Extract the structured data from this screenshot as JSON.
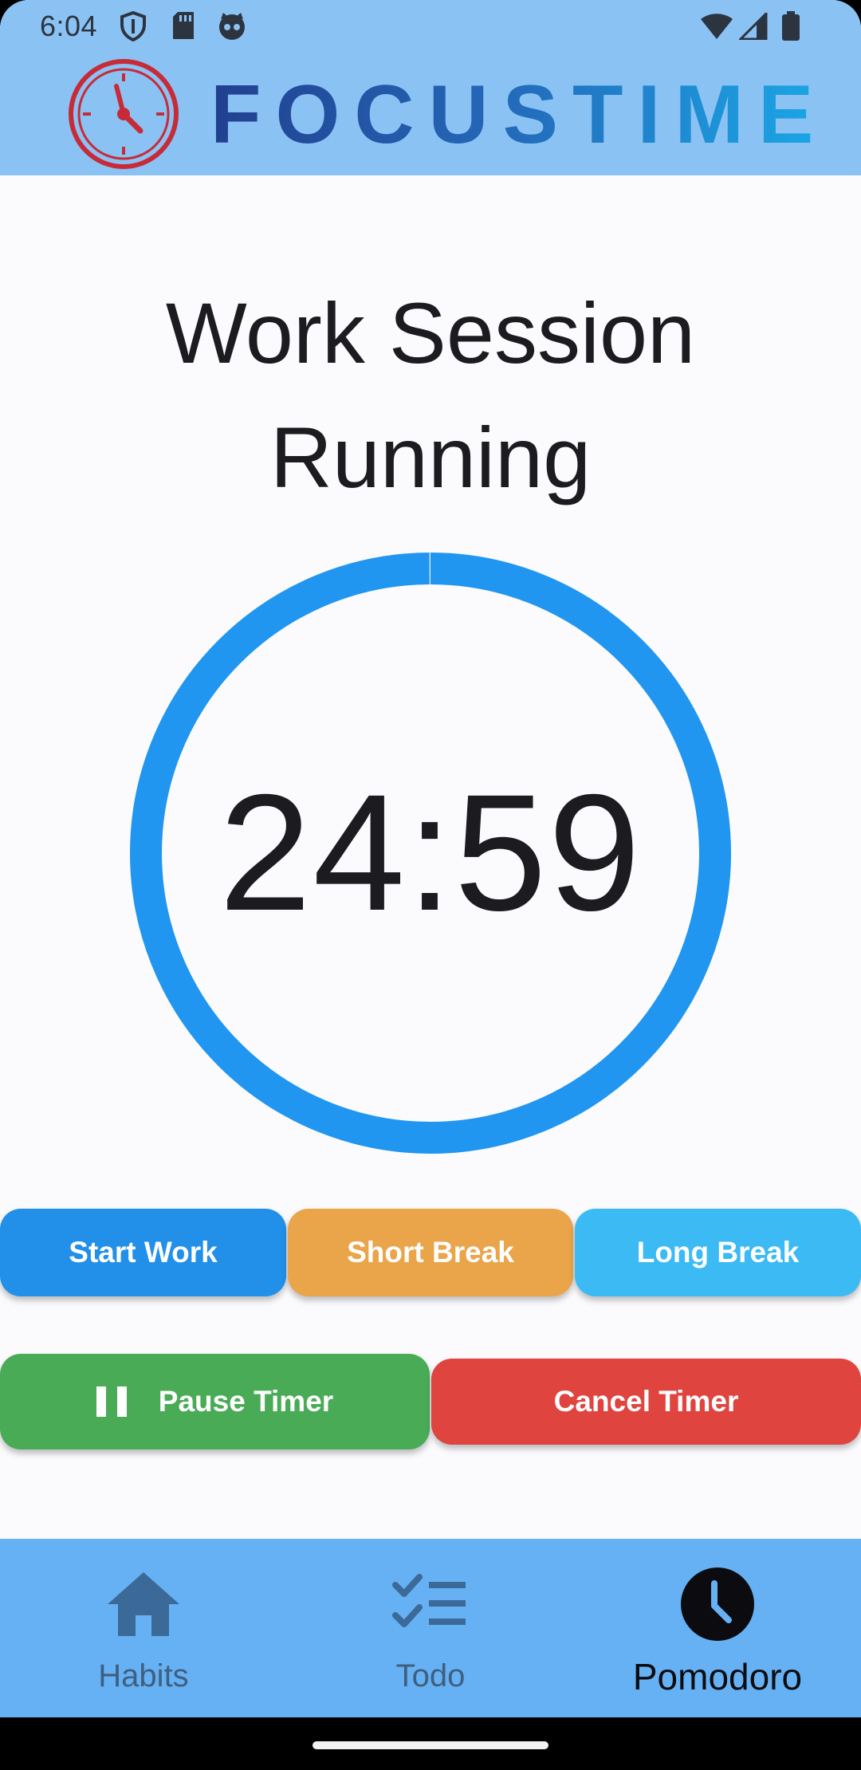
{
  "status_bar": {
    "time": "6:04",
    "icons": [
      "shield-icon",
      "sd-card-icon",
      "cat-icon",
      "wifi-icon",
      "signal-icon",
      "battery-icon"
    ]
  },
  "header": {
    "brand_name": "FOCUSTIME",
    "logo": "clock-logo-icon",
    "background": "#8bc2f4"
  },
  "session": {
    "title": "Work Session Running"
  },
  "timer": {
    "display": "24:59",
    "progress_fraction": 0.9993,
    "ring_color": "#2196f0"
  },
  "buttons": {
    "start_work": "Start Work",
    "short_break": "Short Break",
    "long_break": "Long Break",
    "pause_timer": "Pause Timer",
    "cancel_timer": "Cancel Timer"
  },
  "colors": {
    "start_work": "#2290e9",
    "short_break": "#eaa54b",
    "long_break": "#3bbaf4",
    "pause_timer": "#4aab57",
    "cancel_timer": "#df443e",
    "nav_background": "#66b1f4"
  },
  "bottom_nav": {
    "items": [
      {
        "label": "Habits",
        "icon": "home-icon",
        "selected": false
      },
      {
        "label": "Todo",
        "icon": "checklist-icon",
        "selected": false
      },
      {
        "label": "Pomodoro",
        "icon": "clock-icon",
        "selected": true
      }
    ]
  }
}
